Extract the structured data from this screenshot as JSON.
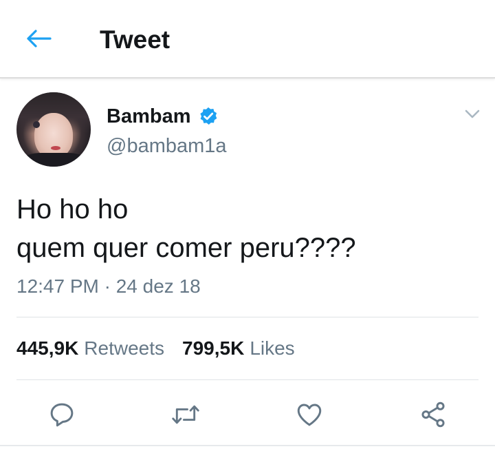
{
  "header": {
    "title": "Tweet",
    "back_icon": "arrow-left-icon"
  },
  "colors": {
    "accent": "#1da1f2",
    "text_primary": "#14171a",
    "text_secondary": "#657786"
  },
  "tweet": {
    "author": {
      "display_name": "Bambam",
      "username": "@bambam1a",
      "verified_icon": "verified-badge-icon"
    },
    "text": "Ho ho ho\nquem quer comer peru????",
    "timestamp": "12:47 PM · 24 dez 18",
    "stats": {
      "retweets_value": "445,9K",
      "retweets_label": "Retweets",
      "likes_value": "799,5K",
      "likes_label": "Likes"
    },
    "actions": [
      {
        "name": "reply",
        "icon": "reply-icon"
      },
      {
        "name": "retweet",
        "icon": "retweet-icon"
      },
      {
        "name": "like",
        "icon": "heart-icon"
      },
      {
        "name": "share",
        "icon": "share-icon"
      }
    ]
  }
}
